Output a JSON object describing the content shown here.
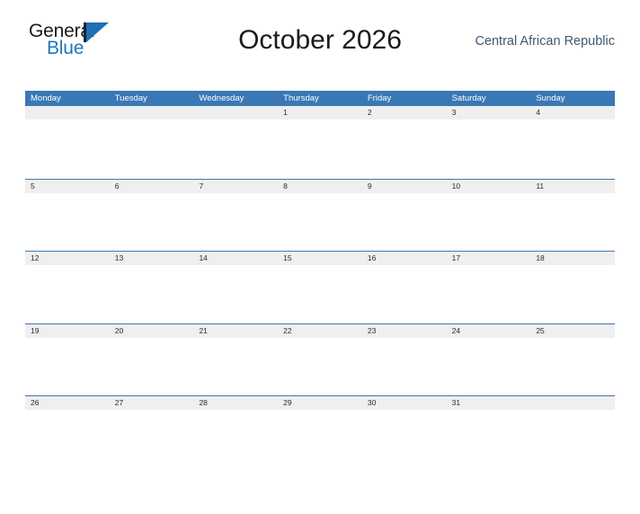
{
  "logo": {
    "word_one": "General",
    "word_two": "Blue",
    "icon": "triangle-flag-icon",
    "color_dark": "#12243a",
    "color_blue": "#1f6fb2"
  },
  "header": {
    "title": "October 2026",
    "country": "Central African Republic"
  },
  "theme": {
    "header_blue": "#3a78b5",
    "date_strip_gray": "#efefef",
    "country_text": "#3f5870",
    "title_text": "#1a1a1a"
  },
  "calendar": {
    "weekdays": [
      "Monday",
      "Tuesday",
      "Wednesday",
      "Thursday",
      "Friday",
      "Saturday",
      "Sunday"
    ],
    "weeks": [
      {
        "days": [
          "",
          "",
          "",
          "1",
          "2",
          "3",
          "4"
        ]
      },
      {
        "days": [
          "5",
          "6",
          "7",
          "8",
          "9",
          "10",
          "11"
        ]
      },
      {
        "days": [
          "12",
          "13",
          "14",
          "15",
          "16",
          "17",
          "18"
        ]
      },
      {
        "days": [
          "19",
          "20",
          "21",
          "22",
          "23",
          "24",
          "25"
        ]
      },
      {
        "days": [
          "26",
          "27",
          "28",
          "29",
          "30",
          "31",
          ""
        ]
      }
    ]
  }
}
